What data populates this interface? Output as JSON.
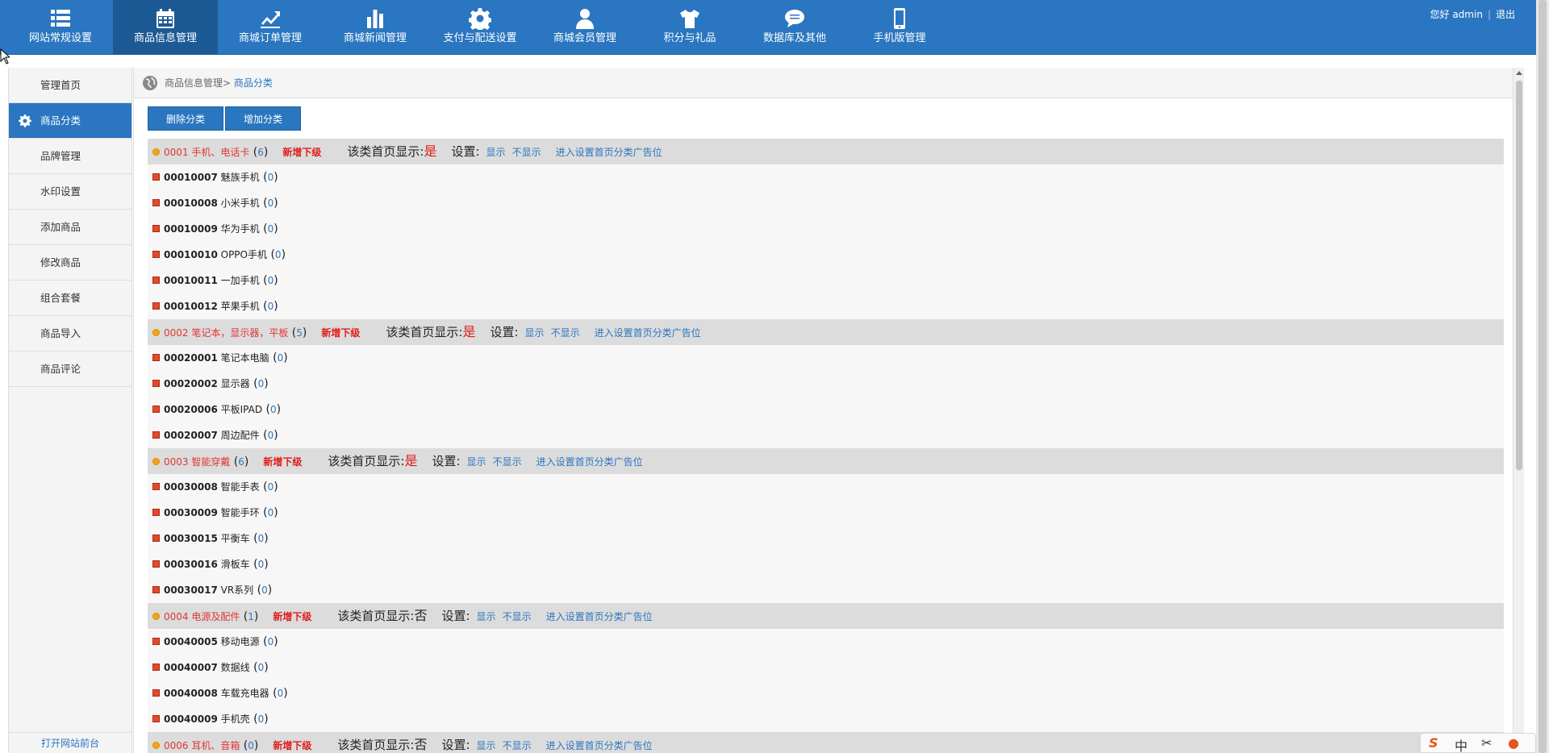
{
  "nav": [
    {
      "label": "网站常规设置",
      "icon": "list-icon"
    },
    {
      "label": "商品信息管理",
      "icon": "calendar-icon",
      "active": true
    },
    {
      "label": "商城订单管理",
      "icon": "trend-icon"
    },
    {
      "label": "商城新闻管理",
      "icon": "bar-chart-icon"
    },
    {
      "label": "支付与配送设置",
      "icon": "gear-icon"
    },
    {
      "label": "商城会员管理",
      "icon": "user-icon"
    },
    {
      "label": "积分与礼品",
      "icon": "tshirt-icon"
    },
    {
      "label": "数据库及其他",
      "icon": "chat-icon"
    },
    {
      "label": "手机版管理",
      "icon": "mobile-icon"
    }
  ],
  "user": {
    "greeting": "您好 admin",
    "logout": "退出"
  },
  "sidebar": {
    "items": [
      {
        "label": "管理首页"
      },
      {
        "label": "商品分类",
        "active": true
      },
      {
        "label": "品牌管理"
      },
      {
        "label": "水印设置"
      },
      {
        "label": "添加商品"
      },
      {
        "label": "修改商品"
      },
      {
        "label": "组合套餐"
      },
      {
        "label": "商品导入"
      },
      {
        "label": "商品评论"
      }
    ],
    "bottom_link": "打开网站前台"
  },
  "breadcrumb": {
    "parent": "商品信息管理>",
    "current": "商品分类"
  },
  "toolbar": {
    "delete_label": "删除分类",
    "add_label": "增加分类"
  },
  "labels": {
    "add_child": "新增下级",
    "home_display": "该类首页显示:",
    "settings": "设置:",
    "show": "显示",
    "hide": "不显示",
    "ad_link": "进入设置首页分类广告位"
  },
  "categories": [
    {
      "name": "0001 手机、电话卡",
      "count": "6",
      "home": "是",
      "children": [
        {
          "code": "00010007",
          "name": "魅族手机",
          "count": "0"
        },
        {
          "code": "00010008",
          "name": "小米手机",
          "count": "0"
        },
        {
          "code": "00010009",
          "name": "华为手机",
          "count": "0"
        },
        {
          "code": "00010010",
          "name": "OPPO手机",
          "count": "0"
        },
        {
          "code": "00010011",
          "name": "一加手机",
          "count": "0"
        },
        {
          "code": "00010012",
          "name": "苹果手机",
          "count": "0"
        }
      ]
    },
    {
      "name": "0002 笔记本，显示器，平板",
      "count": "5",
      "home": "是",
      "children": [
        {
          "code": "00020001",
          "name": "笔记本电脑",
          "count": "0"
        },
        {
          "code": "00020002",
          "name": "显示器",
          "count": "0"
        },
        {
          "code": "00020006",
          "name": "平板IPAD",
          "count": "0"
        },
        {
          "code": "00020007",
          "name": "周边配件",
          "count": "0"
        }
      ]
    },
    {
      "name": "0003 智能穿戴",
      "count": "6",
      "home": "是",
      "children": [
        {
          "code": "00030008",
          "name": "智能手表",
          "count": "0"
        },
        {
          "code": "00030009",
          "name": "智能手环",
          "count": "0"
        },
        {
          "code": "00030015",
          "name": "平衡车",
          "count": "0"
        },
        {
          "code": "00030016",
          "name": "滑板车",
          "count": "0"
        },
        {
          "code": "00030017",
          "name": "VR系列",
          "count": "0"
        }
      ]
    },
    {
      "name": "0004 电源及配件",
      "count": "1",
      "home": "否",
      "children": [
        {
          "code": "00040005",
          "name": "移动电源",
          "count": "0"
        },
        {
          "code": "00040007",
          "name": "数据线",
          "count": "0"
        },
        {
          "code": "00040008",
          "name": "车载充电器",
          "count": "0"
        },
        {
          "code": "00040009",
          "name": "手机壳",
          "count": "0"
        }
      ]
    },
    {
      "name": "0006 耳机、音箱",
      "count": "0",
      "home": "否",
      "children": []
    }
  ],
  "ime": {
    "logo": "S",
    "mode": "中"
  },
  "colors": {
    "primary": "#2a76c0",
    "accent_red": "#e01d1d"
  }
}
